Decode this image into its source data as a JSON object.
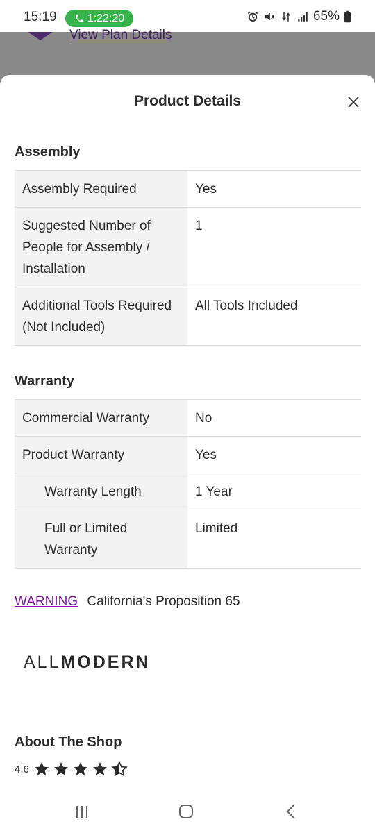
{
  "status_bar": {
    "time": "15:19",
    "call_timer": "1:22:20",
    "battery": "65%",
    "call_color": "#36b24a",
    "icons": [
      "alarm-icon",
      "mute-icon",
      "data-icon",
      "signal-icon",
      "battery-icon"
    ]
  },
  "background": {
    "plan_link": "View Plan Details"
  },
  "sheet": {
    "title": "Product Details",
    "close_icon": "close-icon"
  },
  "assembly": {
    "title": "Assembly",
    "rows": [
      {
        "label": "Assembly Required",
        "value": "Yes"
      },
      {
        "label": "Suggested Number of People for Assembly / Installation",
        "value": "1"
      },
      {
        "label": "Additional Tools Required (Not Included)",
        "value": "All Tools Included"
      }
    ]
  },
  "warranty": {
    "title": "Warranty",
    "rows": [
      {
        "label": "Commercial Warranty",
        "value": "No"
      },
      {
        "label": "Product Warranty",
        "value": "Yes"
      },
      {
        "label": "Warranty Length",
        "value": "1 Year"
      },
      {
        "label": "Full or Limited Warranty",
        "value": "Limited"
      }
    ]
  },
  "warning": {
    "link": "WARNING",
    "text": "California's Proposition 65",
    "link_color": "#7b189f"
  },
  "brand": {
    "part1": "ALL",
    "part2": "MODERN"
  },
  "about": {
    "title": "About The Shop",
    "rating": "4.6",
    "stars_filled": 4,
    "stars_half": 1
  },
  "nav": {
    "icons": [
      "recent-apps-icon",
      "home-icon",
      "back-icon"
    ]
  }
}
